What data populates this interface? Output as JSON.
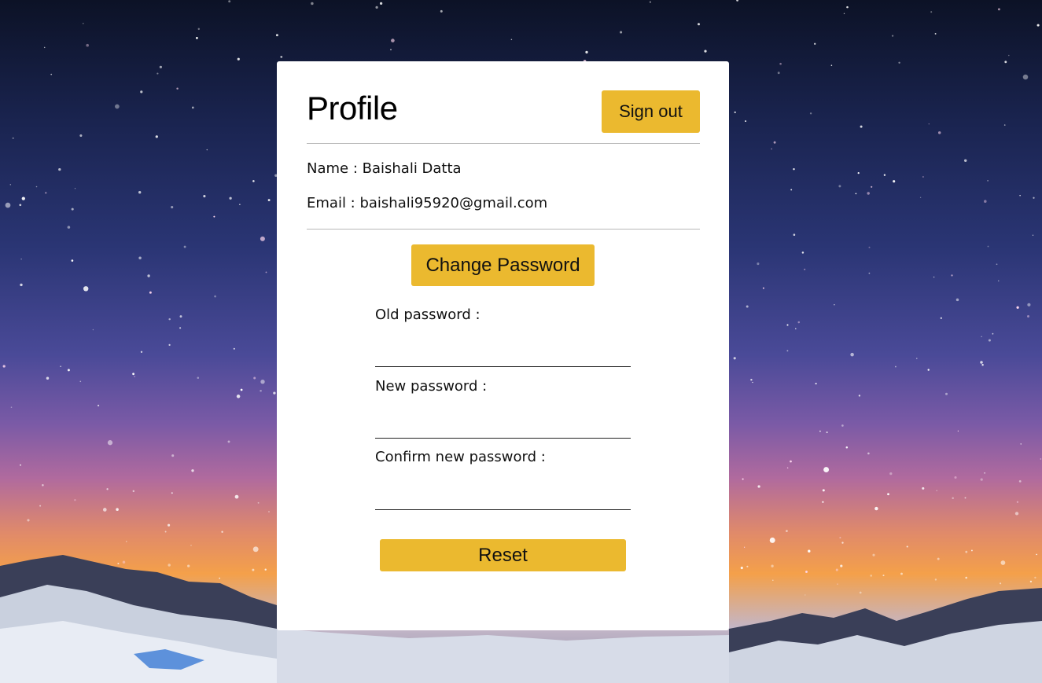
{
  "profile": {
    "title": "Profile",
    "signout_label": "Sign out",
    "name_label": "Name : ",
    "name_value": "Baishali Datta",
    "email_label": "Email : ",
    "email_value": "baishali95920@gmail.com"
  },
  "password": {
    "change_label": "Change Password",
    "old_label": "Old password :",
    "old_value": "",
    "new_label": "New password :",
    "new_value": "",
    "confirm_label": "Confirm new password :",
    "confirm_value": "",
    "reset_label": "Reset"
  },
  "colors": {
    "accent": "#ebb92f",
    "card": "#ffffff"
  }
}
